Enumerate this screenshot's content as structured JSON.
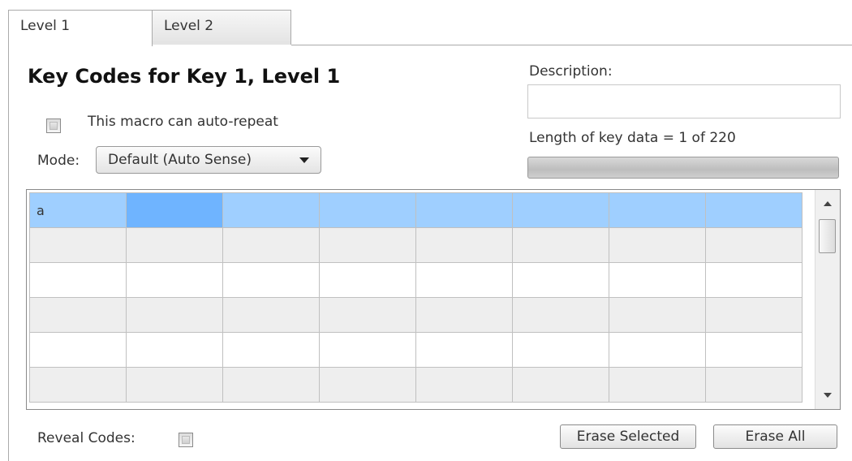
{
  "tabs": [
    {
      "label": "Level 1"
    },
    {
      "label": "Level 2"
    }
  ],
  "heading": "Key Codes for Key 1, Level 1",
  "auto_repeat": {
    "label": "This macro can auto-repeat",
    "checked": false
  },
  "mode": {
    "label": "Mode:",
    "value": "Default (Auto Sense)"
  },
  "description": {
    "label": "Description:",
    "value": ""
  },
  "length": {
    "text": "Length of key data = 1 of 220",
    "used": 1,
    "max": 220
  },
  "grid": {
    "rows": [
      [
        "a",
        "",
        "",
        "",
        "",
        "",
        "",
        ""
      ],
      [
        "",
        "",
        "",
        "",
        "",
        "",
        "",
        ""
      ],
      [
        "",
        "",
        "",
        "",
        "",
        "",
        "",
        ""
      ],
      [
        "",
        "",
        "",
        "",
        "",
        "",
        "",
        ""
      ],
      [
        "",
        "",
        "",
        "",
        "",
        "",
        "",
        ""
      ],
      [
        "",
        "",
        "",
        "",
        "",
        "",
        "",
        ""
      ]
    ]
  },
  "reveal_codes": {
    "label": "Reveal Codes:",
    "checked": false
  },
  "buttons": {
    "erase_selected": "Erase Selected",
    "erase_all": "Erase All"
  }
}
